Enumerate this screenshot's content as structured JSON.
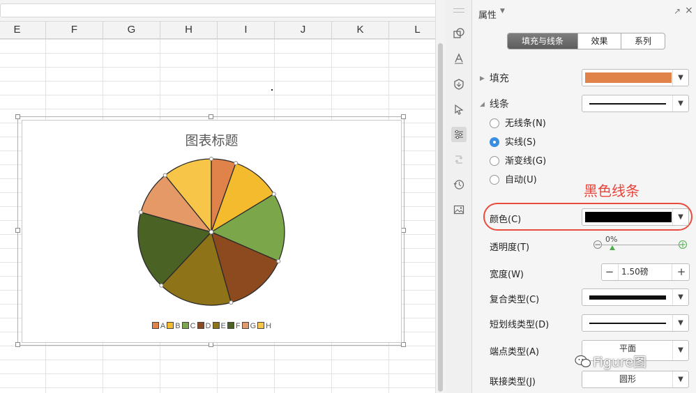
{
  "spreadsheet": {
    "columns": [
      "E",
      "F",
      "G",
      "H",
      "I",
      "J",
      "K",
      "L"
    ]
  },
  "chart": {
    "title": "图表标题",
    "legend": [
      "A",
      "B",
      "C",
      "D",
      "E",
      "F",
      "G",
      "H"
    ],
    "colors": [
      "#e0834a",
      "#f5bb2f",
      "#7ca64a",
      "#8e4a1f",
      "#8f7318",
      "#4b6225",
      "#e49966",
      "#f7c548"
    ]
  },
  "chart_data": {
    "type": "pie",
    "title": "图表标题",
    "categories": [
      "A",
      "B",
      "C",
      "D",
      "E",
      "F",
      "G",
      "H"
    ],
    "values": [
      5,
      10,
      14,
      13,
      15,
      16,
      9,
      10
    ],
    "legend_position": "bottom"
  },
  "panel": {
    "title": "属性",
    "tabs": [
      "填充与线条",
      "效果",
      "系列"
    ],
    "active_tab": 0,
    "fill": {
      "label": "填充",
      "color": "#e0834a"
    },
    "line": {
      "label": "线条",
      "options": [
        "无线条(N)",
        "实线(S)",
        "渐变线(G)",
        "自动(U)"
      ],
      "selected": 1
    },
    "annotation": "黑色线条",
    "color_label": "颜色(C)",
    "line_color": "#000000",
    "transparency_label": "透明度(T)",
    "transparency_value": "0%",
    "width_label": "宽度(W)",
    "width_value": "1.50磅",
    "compound_label": "复合类型(C)",
    "dash_label": "短划线类型(D)",
    "cap_label": "端点类型(A)",
    "cap_value": "平面",
    "join_label": "联接类型(J)",
    "join_value": "圆形"
  },
  "watermark": "Figure图"
}
